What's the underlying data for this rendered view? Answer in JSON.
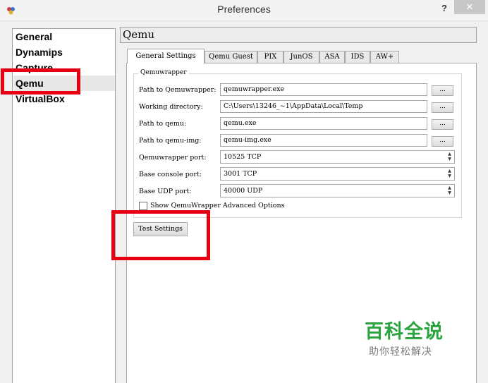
{
  "window": {
    "title": "Preferences",
    "help": "?",
    "close": "✕"
  },
  "sidebar": {
    "items": [
      {
        "label": "General"
      },
      {
        "label": "Dynamips"
      },
      {
        "label": "Capture"
      },
      {
        "label": "Qemu"
      },
      {
        "label": "VirtualBox"
      }
    ]
  },
  "page_title": "Qemu",
  "tabs": [
    {
      "label": "General Settings"
    },
    {
      "label": "Qemu Guest"
    },
    {
      "label": "PIX"
    },
    {
      "label": "JunOS"
    },
    {
      "label": "ASA"
    },
    {
      "label": "IDS"
    },
    {
      "label": "AW+"
    }
  ],
  "group": {
    "title": "Qemuwrapper",
    "fields": [
      {
        "label": "Path to Qemuwrapper:",
        "value": "qemuwrapper.exe",
        "button": "..."
      },
      {
        "label": "Working directory:",
        "value": "C:\\Users\\13246_~1\\AppData\\Local\\Temp",
        "button": "..."
      },
      {
        "label": "Path to qemu:",
        "value": "qemu.exe",
        "button": "..."
      },
      {
        "label": "Path to qemu-img:",
        "value": "qemu-img.exe",
        "button": "..."
      }
    ],
    "spinners": [
      {
        "label": "Qemuwrapper port:",
        "value": "10525 TCP"
      },
      {
        "label": "Base console port:",
        "value": "3001 TCP"
      },
      {
        "label": "Base UDP port:",
        "value": "40000 UDP"
      }
    ],
    "checkbox": {
      "label": "Show QemuWrapper Advanced Options",
      "checked": false
    }
  },
  "test_button": "Test Settings",
  "watermark": {
    "line1": "百科全说",
    "line2": "助你轻松解决"
  },
  "colors": {
    "highlight": "#e60012",
    "watermark_green": "#2aa43e"
  }
}
